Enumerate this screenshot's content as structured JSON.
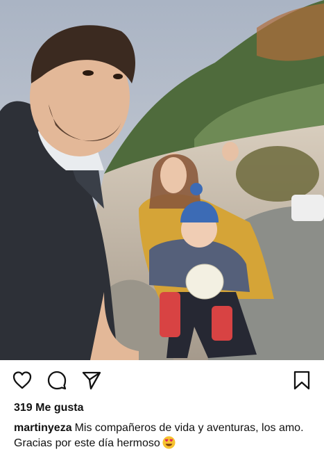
{
  "post": {
    "image": {
      "description": "Selfie of a man with a woman and a toddler in a blue knit hat sitting on rocks on a mountain trail"
    },
    "actions": {
      "like_icon": "heart-icon",
      "comment_icon": "comment-icon",
      "share_icon": "send-icon",
      "save_icon": "bookmark-icon"
    },
    "likes": "319 Me gusta",
    "caption": {
      "username": "martinyeza",
      "text": "Mis compañeros de vida y aventuras, los amo. Gracias por este día hermoso",
      "emoji": "heart-eyes-emoji"
    }
  },
  "colors": {
    "text": "#111111",
    "background": "#ffffff",
    "emoji": "#f7c22f",
    "emoji_heart": "#e0245e"
  }
}
